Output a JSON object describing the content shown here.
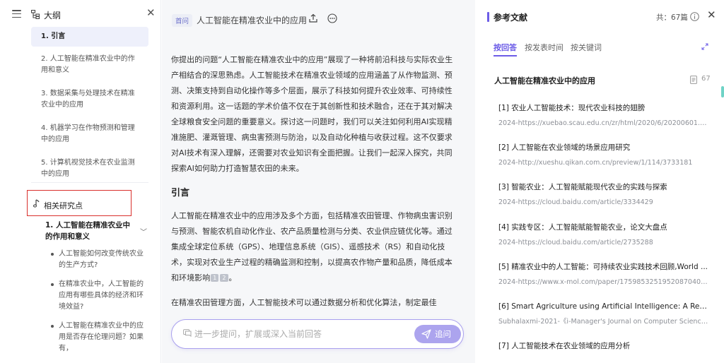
{
  "outline": {
    "title": "大纲",
    "items": [
      {
        "label": "1. 引言",
        "active": true
      },
      {
        "label": "2. 人工智能在精准农业中的作用和意义"
      },
      {
        "label": "3. 数据采集与处理技术在精准农业中的应用"
      },
      {
        "label": "4. 机器学习在作物预测和管理中的应用"
      },
      {
        "label": "5. 计算机视觉技术在农业监测中的应用"
      }
    ],
    "research": {
      "label": "相关研究点",
      "question_title": "1. 人工智能在精准农业中的作用和意义",
      "questions": [
        "人工智能如何改变传统农业的生产方式?",
        "在精准农业中，人工智能的应用有哪些具体的经济和环境效益?",
        "人工智能在精准农业中的应用是否存在伦理问题？如果有，"
      ]
    }
  },
  "main": {
    "tag": "首问",
    "title": "人工智能在精准农业中的应用",
    "intro": "你提出的问题“人工智能在精准农业中的应用”展现了一种将前沿科技与实际农业生产相结合的深思熟虑。人工智能技术在精准农业领域的应用涵盖了从作物监测、预测、决策支持到自动化操作等多个层面，展示了科技如何提升农业效率、可持续性和资源利用。这一话题的学术价值不仅在于其创新性和技术融合，还在于其对解决全球粮食安全问题的重要意义。探讨这一问题时，我们可以关注如何利用AI实现精准施肥、灌溉管理、病虫害预测与防治，以及自动化种植与收获过程。这不仅要求对AI技术有深入理解，还需要对农业知识有全面把握。让我们一起深入探究，共同探索AI如何助力打造智慧农田的未来。",
    "section_heading": "引言",
    "para2": "人工智能在精准农业中的应用涉及多个方面，包括精准农田管理、作物病虫害识别与预测、智能农机自动化作业、农产品质量检测与分类、农业供应链优化等。通过集成全球定位系统（GPS）、地理信息系统（GIS）、遥感技术（RS）和自动化技术，实现对农业生产过程的精确监测和控制，以提高农作物产量和品质，降低成本和环境影响",
    "cite1": "1",
    "cite2": "2",
    "para2_end": "。",
    "para3": "在精准农田管理方面，人工智能技术可以通过数据分析和优化算法，制定最佳",
    "ask_placeholder": "进一步提问，扩展或深入当前回答",
    "ask_button": "追问"
  },
  "references": {
    "title": "参考文献",
    "count": "共：67篇",
    "tabs": [
      "按回答",
      "按发表时间",
      "按关键词"
    ],
    "section_title": "人工智能在精准农业中的应用",
    "section_count": "67",
    "items": [
      {
        "title": "[1] 农业人工智能技术：现代农业科技的翅膀",
        "source": "2024-https://xuebao.scau.edu.cn/zr/html/2020/6/20200601.htm"
      },
      {
        "title": "[2] 人工智能在农业领域的场景应用研究",
        "source": "2024-http://xueshu.qikan.com.cn/preview/1/114/3733181"
      },
      {
        "title": "[3] 智能农业：人工智能赋能现代农业的实践与探索",
        "source": "2024-https://cloud.baidu.com/article/3334429"
      },
      {
        "title": "[4] 实践专区：人工智能赋能智能农业，论文大盘点",
        "source": "2024-https://cloud.baidu.com/article/2735288"
      },
      {
        "title": "[5] 精准农业中的人工智能：可持续农业实践技术回顾,World ...",
        "source": "2024-https://www.x-mol.com/paper/1759853251952087040/t?..."
      },
      {
        "title": "[6] Smart Agriculture using Artificial Intelligence: A Review",
        "source": "Subhalaxmi-2021-《i-Manager's Journal on Computer Science;》"
      },
      {
        "title": "[7] 人工智能技术在农业领域的应用分析",
        "source": ""
      }
    ]
  },
  "colors": {
    "accent": "#6c5ce7",
    "highlight_border": "#d9302c",
    "ask_button": "#aca4ee"
  },
  "icons": [
    "menu-icon",
    "outline-icon",
    "close-icon",
    "music-note-icon",
    "chevron-down-icon",
    "share-icon",
    "more-icon",
    "chat-icon",
    "send-icon",
    "info-icon",
    "expand-icon",
    "document-icon"
  ]
}
